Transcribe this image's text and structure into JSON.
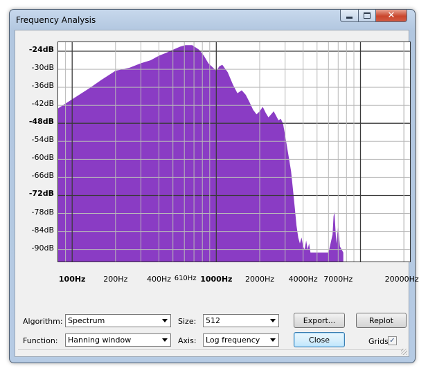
{
  "window": {
    "title": "Frequency Analysis"
  },
  "plot": {
    "fill_color": "#8a3cc4",
    "y_labels": [
      {
        "text": "-24dB",
        "db": -24,
        "bold": true
      },
      {
        "text": "-30dB",
        "db": -30,
        "bold": false
      },
      {
        "text": "-36dB",
        "db": -36,
        "bold": false
      },
      {
        "text": "-42dB",
        "db": -42,
        "bold": false
      },
      {
        "text": "-48dB",
        "db": -48,
        "bold": true
      },
      {
        "text": "-54dB",
        "db": -54,
        "bold": false
      },
      {
        "text": "-60dB",
        "db": -60,
        "bold": false
      },
      {
        "text": "-66dB",
        "db": -66,
        "bold": false
      },
      {
        "text": "-72dB",
        "db": -72,
        "bold": true
      },
      {
        "text": "-78dB",
        "db": -78,
        "bold": false
      },
      {
        "text": "-84dB",
        "db": -84,
        "bold": false
      },
      {
        "text": "-90dB",
        "db": -90,
        "bold": false
      }
    ],
    "x_labels": [
      {
        "text": "100Hz",
        "hz": 100,
        "bold": true
      },
      {
        "text": "200Hz",
        "hz": 200,
        "bold": false
      },
      {
        "text": "400Hz",
        "hz": 400,
        "bold": false
      },
      {
        "text": "610Hz",
        "hz": 610,
        "bold": false,
        "small": true
      },
      {
        "text": "1000Hz",
        "hz": 1000,
        "bold": true
      },
      {
        "text": "2000Hz",
        "hz": 2000,
        "bold": false
      },
      {
        "text": "4000Hz",
        "hz": 4000,
        "bold": false
      },
      {
        "text": "7000Hz",
        "hz": 7000,
        "bold": false
      },
      {
        "text": "20000Hz",
        "hz": 20000,
        "bold": false
      }
    ]
  },
  "chart_data": {
    "type": "area",
    "x_scale": "log",
    "xlim": [
      80,
      22050
    ],
    "ylim": [
      -94,
      -21
    ],
    "grid": true,
    "x": [
      80,
      100,
      130,
      160,
      200,
      250,
      300,
      350,
      400,
      450,
      500,
      560,
      610,
      680,
      760,
      820,
      880,
      950,
      1000,
      1050,
      1100,
      1200,
      1300,
      1400,
      1500,
      1600,
      1700,
      1800,
      1900,
      2000,
      2100,
      2200,
      2300,
      2400,
      2500,
      2600,
      2700,
      2800,
      2900,
      3000,
      3100,
      3200,
      3300,
      3400,
      3500,
      3600,
      3700,
      3800,
      3900,
      4000,
      4100,
      4200,
      4300,
      4400,
      4500,
      6000,
      6200,
      6400,
      6500,
      6600,
      6700,
      6800,
      7000,
      7200,
      7400,
      7600
    ],
    "y": [
      -43,
      -40,
      -36.5,
      -33.5,
      -30.5,
      -29.5,
      -28,
      -27,
      -25.5,
      -24.5,
      -23.5,
      -22.5,
      -22,
      -22,
      -23.5,
      -25.5,
      -28,
      -29.5,
      -30.5,
      -29,
      -28.5,
      -31,
      -35,
      -38,
      -37,
      -38.5,
      -41,
      -43.5,
      -45,
      -44,
      -42.5,
      -44.5,
      -46,
      -45,
      -44,
      -45.5,
      -47,
      -46.5,
      -48,
      -52,
      -56,
      -60,
      -64,
      -70,
      -76,
      -82,
      -86,
      -88,
      -86,
      -89,
      -90,
      -87,
      -90,
      -88,
      -91,
      -91,
      -88,
      -85,
      -79,
      -77.5,
      -83,
      -88,
      -82,
      -89,
      -90,
      -91
    ]
  },
  "controls": {
    "algorithm_label": "Algorithm:",
    "algorithm_value": "Spectrum",
    "size_label": "Size:",
    "size_value": "512",
    "function_label": "Function:",
    "function_value": "Hanning window",
    "axis_label": "Axis:",
    "axis_value": "Log frequency",
    "export_label": "Export...",
    "replot_label": "Replot",
    "close_label": "Close",
    "grids_label": "Grids",
    "grids_checked": true
  }
}
